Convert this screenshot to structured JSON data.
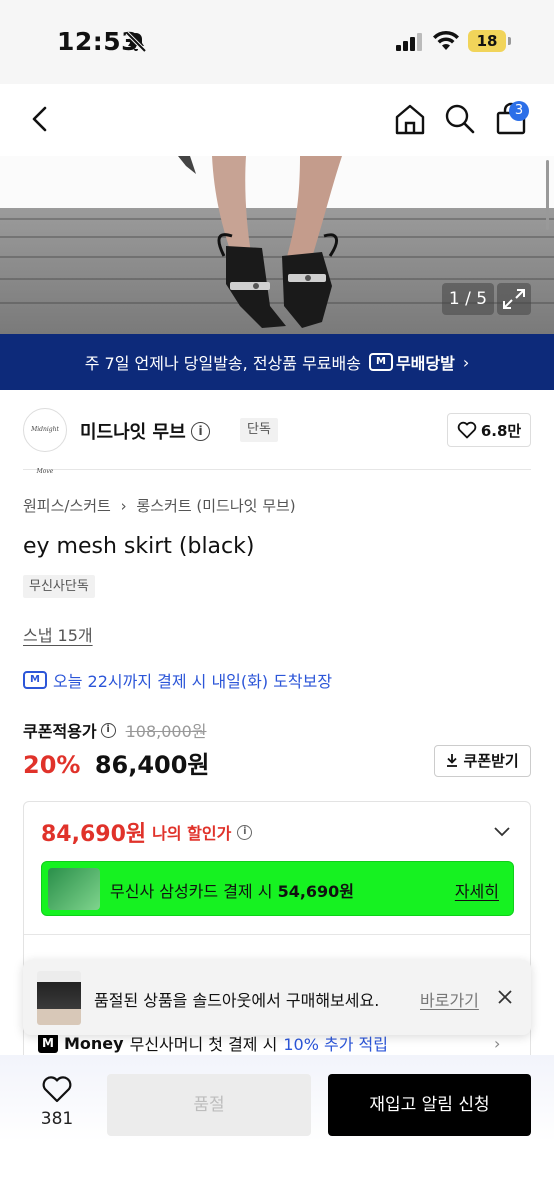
{
  "status_bar": {
    "time": "12:53",
    "battery": "18"
  },
  "nav": {
    "cart_count": "3"
  },
  "gallery": {
    "counter": "1 / 5"
  },
  "promo": {
    "text": "주 7일 언제나 당일발송, 전상품 무료배송",
    "brand_logo": "M",
    "brand_label": "무배당발",
    "chevron": "›"
  },
  "brand": {
    "logo_text": "Midnight Move",
    "name": "미드나잇 무브",
    "exclusive_tag": "단독",
    "likes": "6.8만"
  },
  "product": {
    "breadcrumb_1": "원피스/스커트",
    "breadcrumb_sep": "›",
    "breadcrumb_2": "롱스커트 (미드나잇 무브)",
    "title": "ey mesh skirt (black)",
    "store_tag": "무신사단독",
    "snap_link": "스냅 15개",
    "delivery_logo": "M",
    "delivery": "오늘 22시까지 결제 시 내일(화) 도착보장"
  },
  "price": {
    "coupon_label": "쿠폰적용가",
    "original": "108,000원",
    "discount_pct": "20%",
    "sale": "86,400원",
    "coupon_button": "쿠폰받기"
  },
  "discount": {
    "my_price": "84,690원",
    "my_price_label": "나의 할인가",
    "card_text_pre": "무신사 삼성카드 결제 시",
    "card_amount": "54,690원",
    "card_more": "자세히",
    "money_logo": "M",
    "money_brand": "Money",
    "money_text_pre": "무신사머니 첫 결제 시",
    "money_highlight": "10% 추가 적립",
    "money_chevron": "›"
  },
  "toast": {
    "text": "품절된 상품을 솔드아웃에서 구매해보세요.",
    "link": "바로가기"
  },
  "bottom": {
    "like_count": "381",
    "soldout_label": "품절",
    "restock_label": "재입고 알림 신청"
  },
  "colors": {
    "promo_bg": "#0d2a7a",
    "accent_red": "#e0322a",
    "accent_blue": "#2c56d8",
    "card_green": "#16f221",
    "badge_blue": "#2c6fe8"
  }
}
